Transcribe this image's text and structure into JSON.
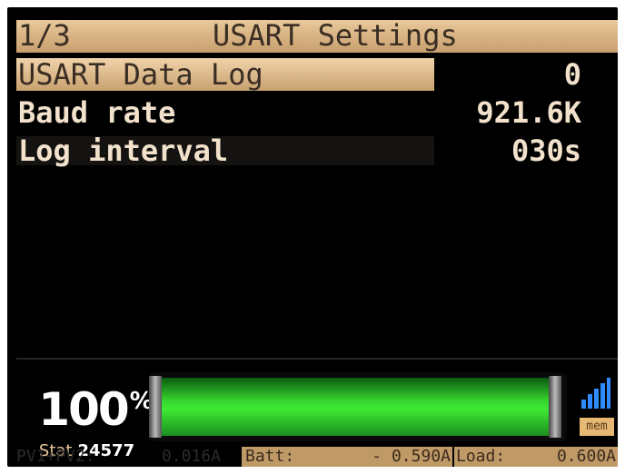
{
  "header": {
    "page_indicator": "1/3",
    "title": "USART Settings"
  },
  "settings": [
    {
      "label": "USART Data Log",
      "value": "0",
      "selected": true
    },
    {
      "label": "Baud rate",
      "value": "921.6K",
      "selected": false
    },
    {
      "label": "Log interval",
      "value": "030s",
      "selected": false
    }
  ],
  "status": {
    "percent_value": "100",
    "percent_symbol": "%",
    "battery_level": 1.0,
    "stat_label": "Stat",
    "stat_value": "24577",
    "signal_icon": "signal-bars-icon",
    "mem_label": "mem"
  },
  "readouts": {
    "pv_label": "PV1+PV2:",
    "pv_value": "0.016A",
    "batt_label": "Batt:",
    "batt_value": "- 0.590A",
    "load_label": "Load:",
    "load_value": "0.600A"
  },
  "colors": {
    "highlight": "#e9c89a",
    "text": "#f2e2cc",
    "battery_green": "#3ee834",
    "mem_badge": "#e6b873"
  }
}
